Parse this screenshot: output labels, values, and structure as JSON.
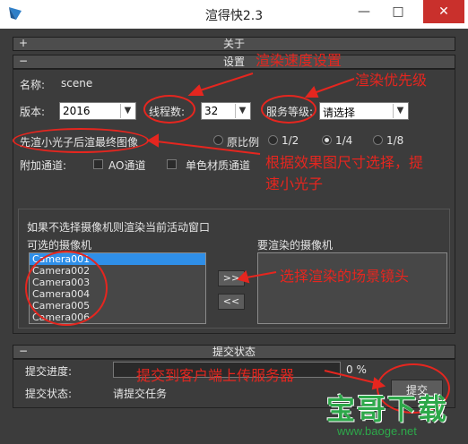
{
  "window": {
    "title": "渲得快2.3",
    "minimize": "—",
    "maximize": "□",
    "close": "✕"
  },
  "sections": {
    "about": "关于",
    "settings": "设置",
    "submit_status": "提交状态"
  },
  "toggles": {
    "collapsed": "+",
    "expanded": "−"
  },
  "settings": {
    "name_label": "名称:",
    "name_value": "scene",
    "version_label": "版本:",
    "version_value": "2016",
    "threads_label": "线程数:",
    "threads_value": "32",
    "service_label": "服务等级:",
    "service_value": "请选择",
    "render_mode": "先渲小光子后渲最终图像",
    "ratio_label": "原比例",
    "ratio_options": [
      "1/2",
      "1/4",
      "1/8"
    ],
    "ratio_selected": "1/4",
    "extra_label": "附加通道:",
    "ao_label": "AO通道",
    "mono_label": "单色材质通道"
  },
  "cameras": {
    "hint": "如果不选择摄像机则渲染当前活动窗口",
    "available_label": "可选的摄像机",
    "render_label": "要渲染的摄像机",
    "available": [
      "Camera001",
      "Camera002",
      "Camera003",
      "Camera004",
      "Camera005",
      "Camera006"
    ],
    "selected_index": 0,
    "add_button": ">>",
    "remove_button": "<<"
  },
  "submit": {
    "progress_label": "提交进度:",
    "progress_value": 0,
    "progress_text": "0 %",
    "status_label": "提交状态:",
    "status_value": "请提交任务",
    "button_label": "提交"
  },
  "annotations": {
    "speed": "渲染速度设置",
    "priority": "渲染优先级",
    "size": "根据效果图尺寸选择，提",
    "size2": "速小光子",
    "camera": "选择渲染的场景镜头",
    "upload": "提交到客户端上传服务器"
  },
  "watermark": {
    "logo": "宝哥下载",
    "url": "www.baoge.net"
  },
  "colors": {
    "annotation": "#e5261f",
    "selection": "#2f8fe8",
    "watermark": "#2da84a"
  }
}
